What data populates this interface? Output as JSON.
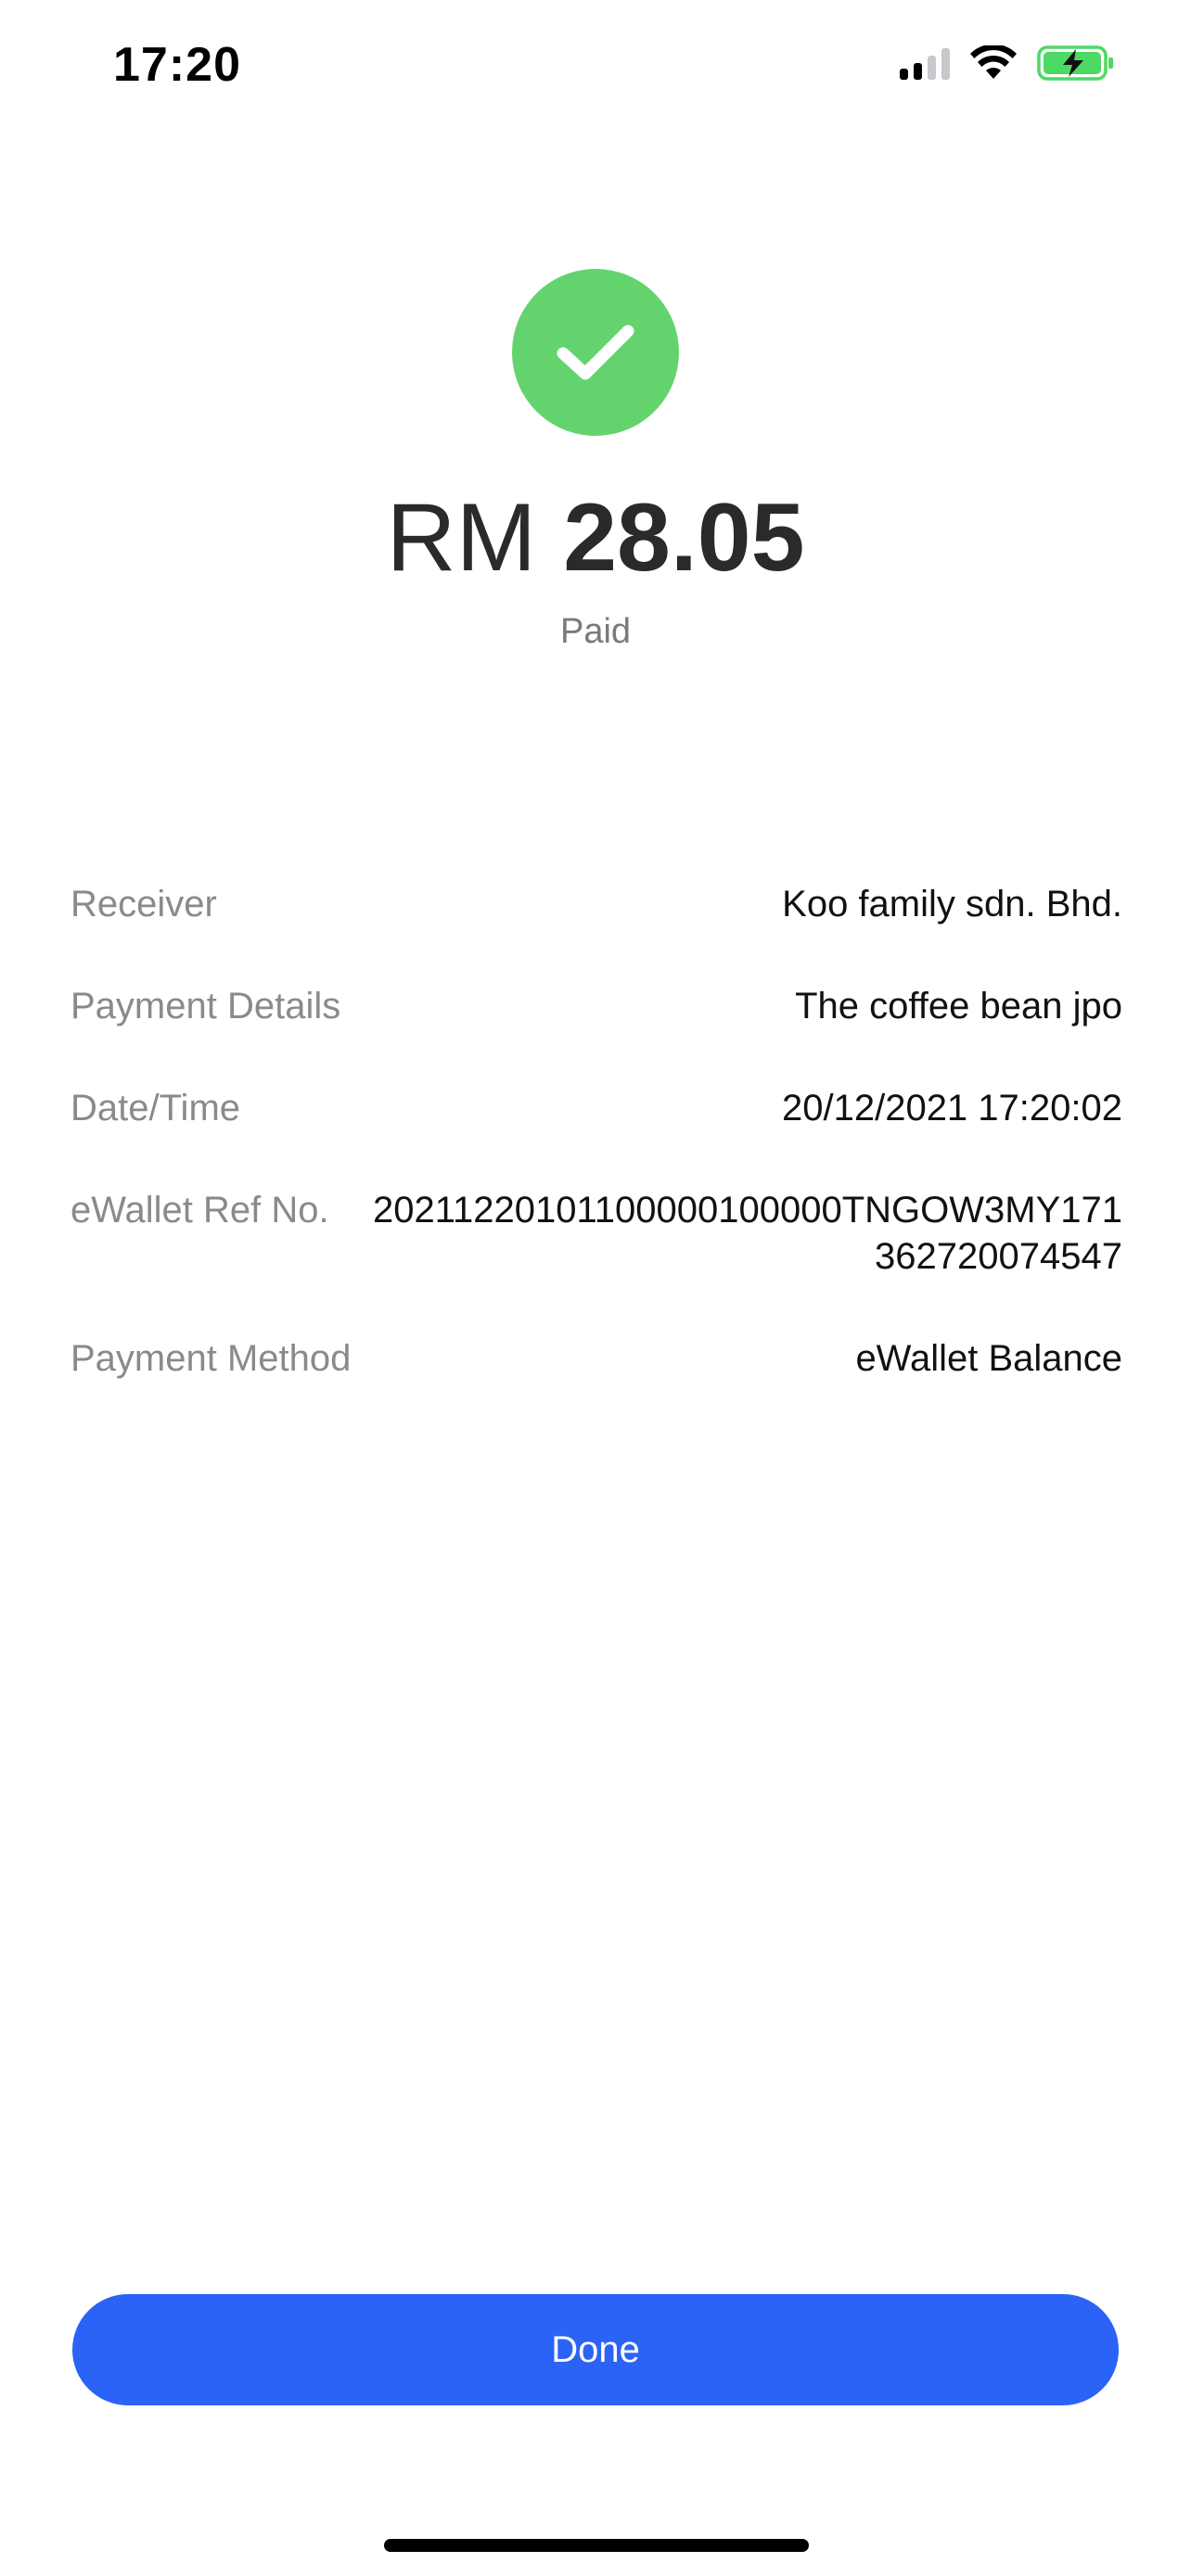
{
  "status_bar": {
    "time": "17:20",
    "icons": [
      "signal-icon",
      "wifi-icon",
      "battery-charging-icon"
    ],
    "battery_color": "#4cd964"
  },
  "result": {
    "icon": "check-icon",
    "icon_color": "#63d46d",
    "currency": "RM",
    "amount": "28.05",
    "status": "Paid"
  },
  "details": {
    "receiver": {
      "label": "Receiver",
      "value": "Koo family sdn. Bhd."
    },
    "payment_details": {
      "label": "Payment Details",
      "value": "The coffee bean jpo"
    },
    "date_time": {
      "label": "Date/Time",
      "value": "20/12/2021 17:20:02"
    },
    "ewallet_ref": {
      "label": "eWallet Ref No.",
      "value": "20211220101100000100000TNGOW3MY171362720074547"
    },
    "payment_method": {
      "label": "Payment Method",
      "value": "eWallet Balance"
    }
  },
  "actions": {
    "done_label": "Done",
    "accent_color": "#2b63f6"
  }
}
